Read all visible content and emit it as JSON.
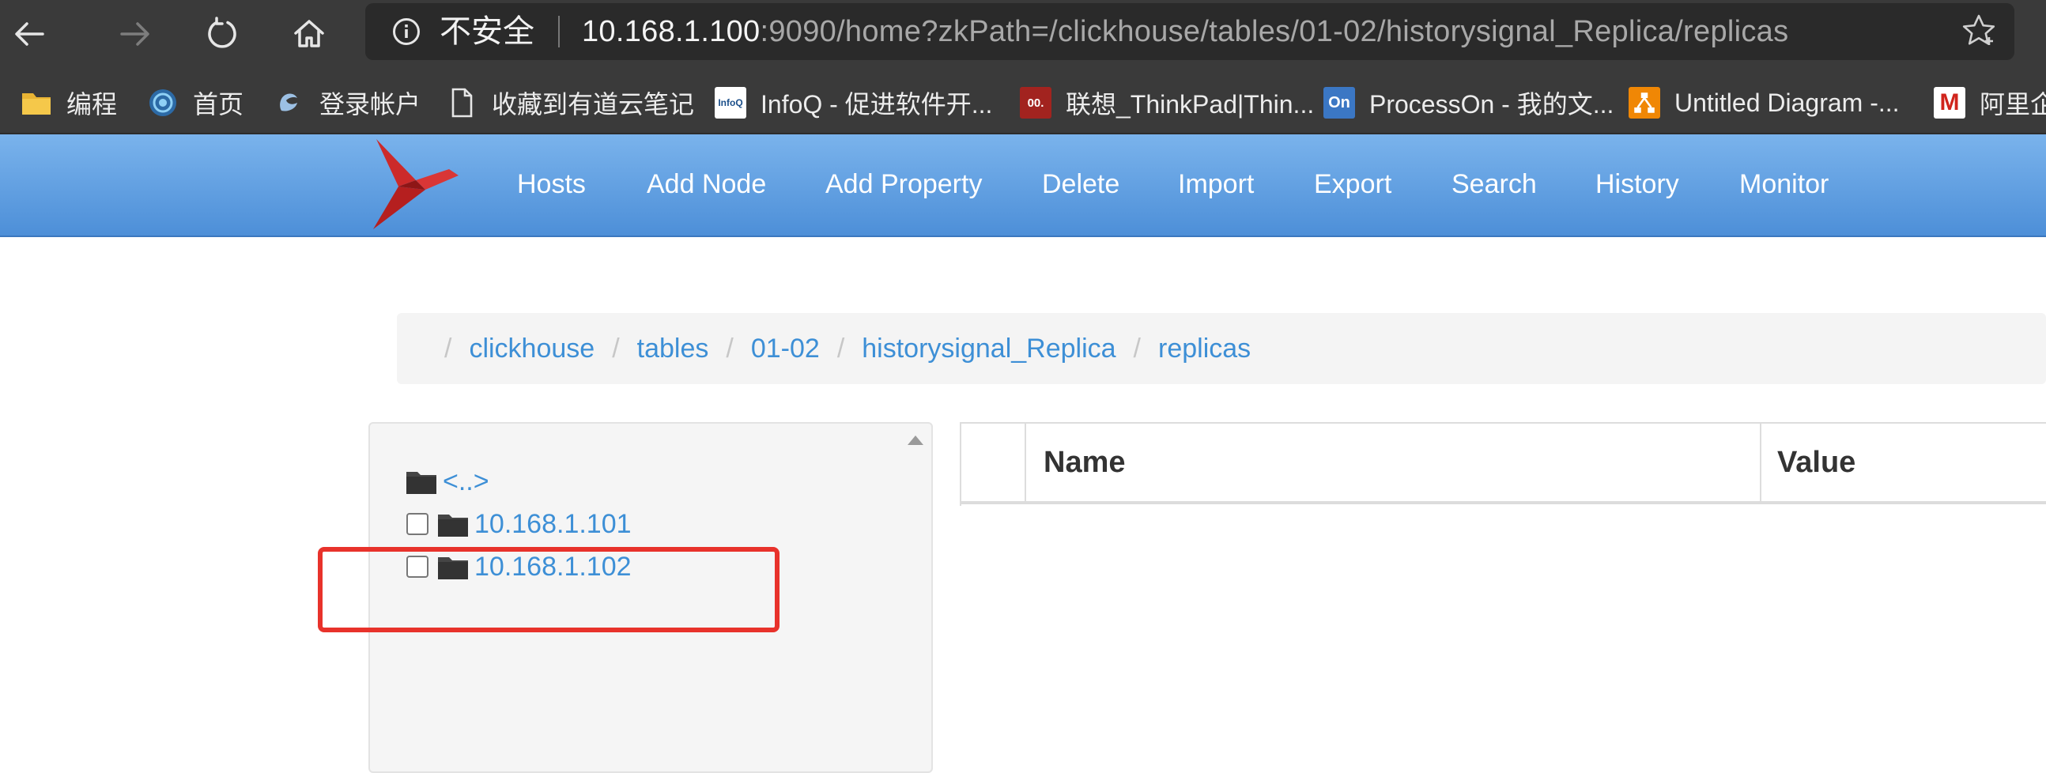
{
  "browser": {
    "security_label": "不安全",
    "url_host": "10.168.1.100",
    "url_rest": ":9090/home?zkPath=/clickhouse/tables/01-02/historysignal_Replica/replicas"
  },
  "bookmarks": [
    {
      "label": "编程",
      "icon": "folder-icon"
    },
    {
      "label": "首页",
      "icon": "swirl-icon"
    },
    {
      "label": "登录帐户",
      "icon": "surfshark-icon"
    },
    {
      "label": "收藏到有道云笔记",
      "icon": "page-icon"
    },
    {
      "label": "InfoQ - 促进软件开...",
      "icon": "infoq-icon",
      "icon_text": "InfoQ"
    },
    {
      "label": "联想_ThinkPad|Thin...",
      "icon": "lenovo-icon",
      "icon_text": "00."
    },
    {
      "label": "ProcessOn - 我的文...",
      "icon": "processon-icon",
      "icon_text": "On"
    },
    {
      "label": "Untitled Diagram -...",
      "icon": "drawio-icon"
    },
    {
      "label": "阿里企",
      "icon": "aliyun-mail-icon",
      "icon_text": "M"
    }
  ],
  "navbar": {
    "items": [
      "Hosts",
      "Add Node",
      "Add Property",
      "Delete",
      "Import",
      "Export",
      "Search",
      "History",
      "Monitor"
    ]
  },
  "breadcrumb": [
    "clickhouse",
    "tables",
    "01-02",
    "historysignal_Replica",
    "replicas"
  ],
  "breadcrumb_separator": "/",
  "tree": {
    "parent_label": "<..>",
    "nodes": [
      {
        "label": "10.168.1.101",
        "checked": false
      },
      {
        "label": "10.168.1.102",
        "checked": false
      }
    ]
  },
  "properties_table": {
    "columns": [
      "Name",
      "Value"
    ],
    "rows": []
  },
  "colors": {
    "navbar_top": "#7ab3ec",
    "navbar_bottom": "#4d8fd8",
    "link": "#3d8fd6",
    "highlight": "#e8322b"
  }
}
